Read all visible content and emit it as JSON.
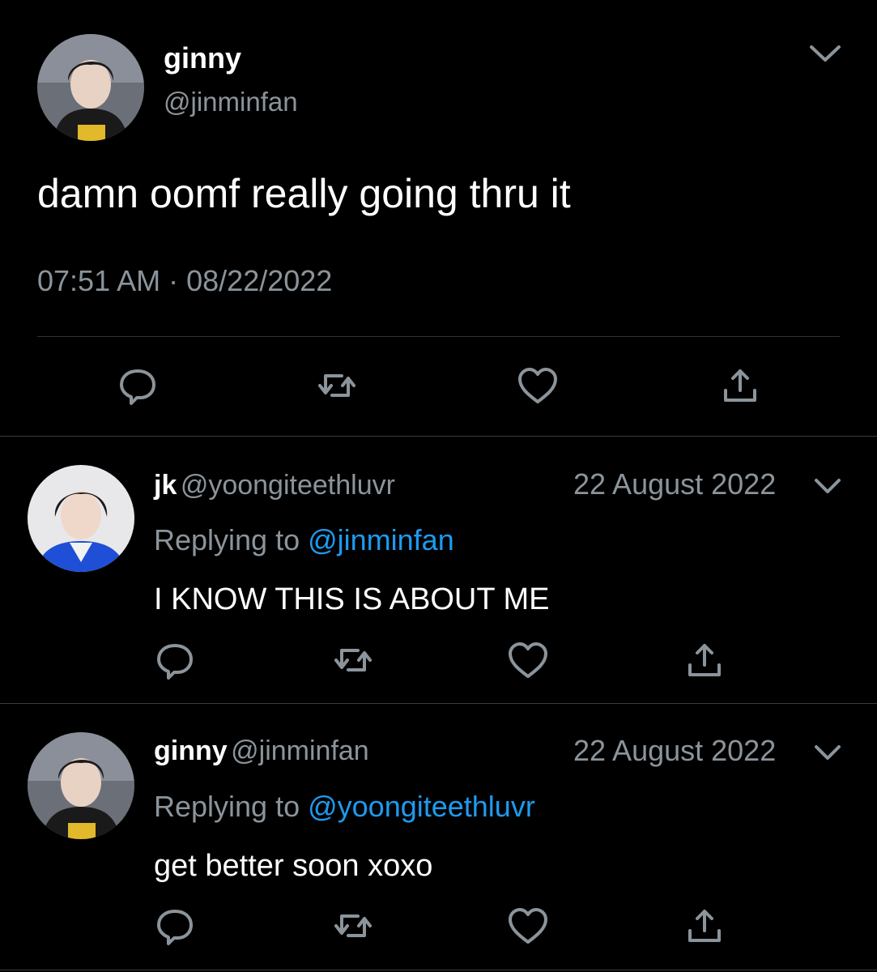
{
  "main_tweet": {
    "display_name": "ginny",
    "handle": "@jinminfan",
    "text": "damn oomf really going thru it",
    "time": "07:51 AM",
    "separator": "·",
    "date": "08/22/2022",
    "menu_icon": "chevron-down-icon",
    "actions": [
      "reply-icon",
      "retweet-icon",
      "like-icon",
      "share-icon"
    ]
  },
  "replies": [
    {
      "display_name": "jk",
      "handle": "@yoongiteethluvr",
      "date": "22 August 2022",
      "replying_prefix": "Replying to ",
      "replying_to": "@jinminfan",
      "text": "I KNOW THIS IS ABOUT ME",
      "avatar_accent": "#1f4fd6"
    },
    {
      "display_name": "ginny",
      "handle": "@jinminfan",
      "date": "22 August 2022",
      "replying_prefix": "Replying to ",
      "replying_to": "@yoongiteethluvr",
      "text": "get better soon xoxo",
      "avatar_accent": "#e1b92a"
    }
  ],
  "colors": {
    "background": "#000000",
    "primary_text": "#ffffff",
    "secondary_text": "#8b949b",
    "link": "#1d9bf0",
    "icon": "#8b949b",
    "divider": "#2f3336"
  }
}
